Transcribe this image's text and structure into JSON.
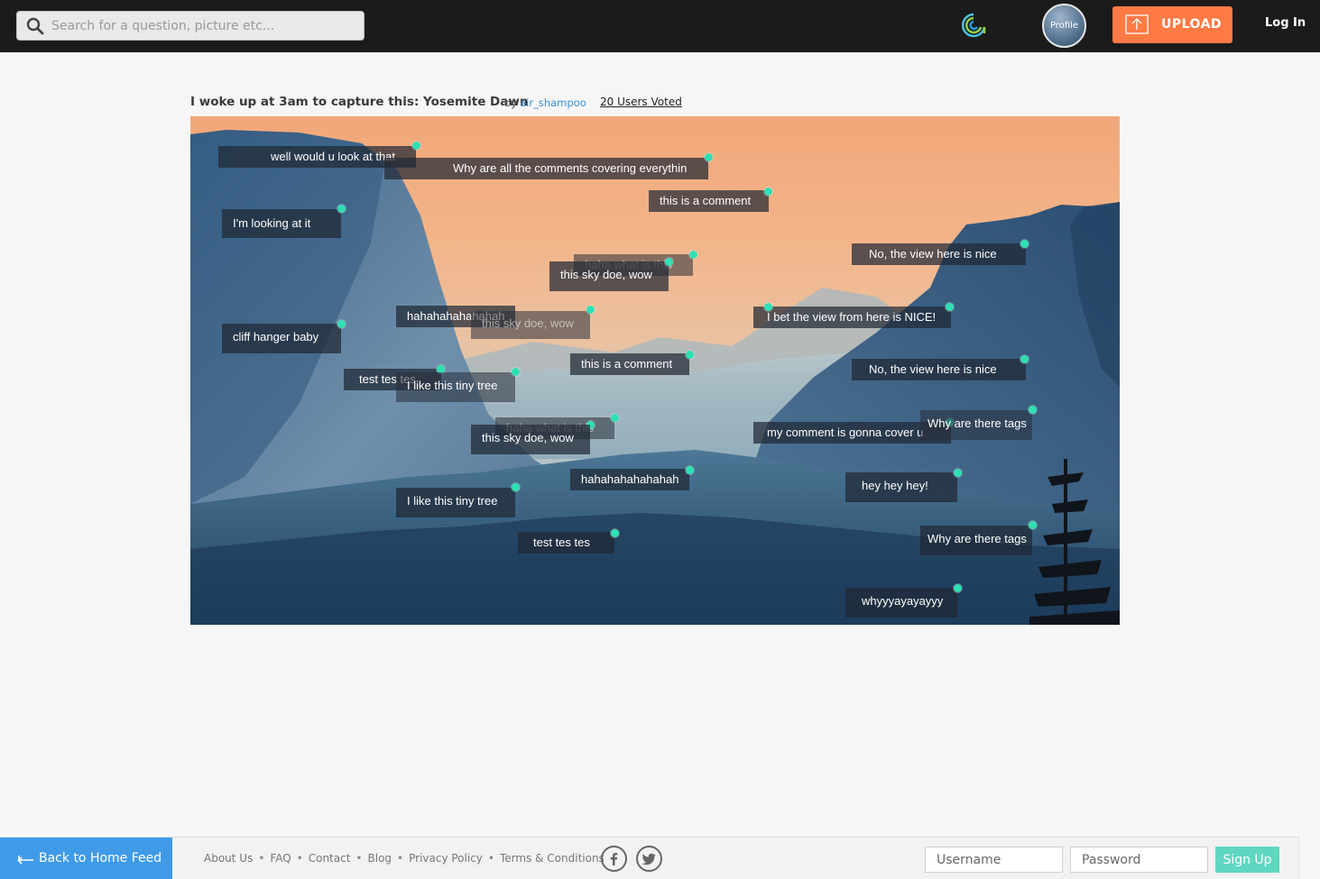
{
  "header": {
    "search_placeholder": "Search for a question, picture etc...",
    "profile_label": "Profile",
    "upload_label": "UPLOAD",
    "login_label": "Log In",
    "accent_color": "#ff7a45"
  },
  "post": {
    "title": "I woke up at 3am to capture this: Yosemite Dawn",
    "by_label": "by",
    "author": "air_shampoo",
    "votes_label": "20 Users Voted"
  },
  "comments": [
    {
      "text": "well would u look at that"
    },
    {
      "text": "Why are all the comments covering everythin"
    },
    {
      "text": "this is a comment"
    },
    {
      "text": "I'm looking at it"
    },
    {
      "text": "No, the view here is nice"
    },
    {
      "text": "haha what is this"
    },
    {
      "text": "this sky doe, wow"
    },
    {
      "text": "hahahahahahahah"
    },
    {
      "text": "this sky doe, wow"
    },
    {
      "text": "I bet the view from here is NICE!"
    },
    {
      "text": "cliff hanger baby"
    },
    {
      "text": "this is a comment"
    },
    {
      "text": "No, the view here is nice"
    },
    {
      "text": "test tes tes"
    },
    {
      "text": "I like this tiny tree"
    },
    {
      "text": "haha what is this"
    },
    {
      "text": "this sky doe, wow"
    },
    {
      "text": "my comment is gonna cover u"
    },
    {
      "text": "Why are there tags"
    },
    {
      "text": "hahahahahahahah"
    },
    {
      "text": "hey  hey hey!"
    },
    {
      "text": "I like this tiny tree"
    },
    {
      "text": "test tes tes"
    },
    {
      "text": "Why are there tags"
    },
    {
      "text": "whyyyayayayyy"
    }
  ],
  "footer": {
    "back_label": "Back to Home Feed",
    "links": [
      "About Us",
      "FAQ",
      "Contact",
      "Blog",
      "Privacy Policy",
      "Terms & Conditions"
    ],
    "username_placeholder": "Username",
    "password_placeholder": "Password",
    "signup_label": "Sign Up"
  }
}
